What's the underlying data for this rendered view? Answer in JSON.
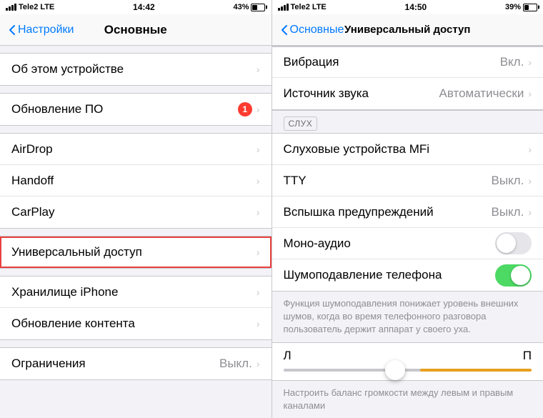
{
  "leftPanel": {
    "statusBar": {
      "carrier": "Tele2",
      "network": "LTE",
      "time": "14:42",
      "battery": 43
    },
    "navBar": {
      "backLabel": "Настройки",
      "title": "Основные"
    },
    "sections": [
      {
        "items": [
          {
            "label": "Об этом устройстве",
            "value": "",
            "badge": ""
          }
        ]
      },
      {
        "items": [
          {
            "label": "Обновление ПО",
            "value": "",
            "badge": "1"
          }
        ]
      },
      {
        "items": [
          {
            "label": "AirDrop",
            "value": "",
            "badge": ""
          },
          {
            "label": "Handoff",
            "value": "",
            "badge": ""
          },
          {
            "label": "CarPlay",
            "value": "",
            "badge": ""
          }
        ]
      },
      {
        "items": [
          {
            "label": "Универсальный доступ",
            "value": "",
            "badge": "",
            "highlighted": true
          }
        ]
      },
      {
        "items": [
          {
            "label": "Хранилище iPhone",
            "value": "",
            "badge": ""
          },
          {
            "label": "Обновление контента",
            "value": "",
            "badge": ""
          }
        ]
      },
      {
        "items": [
          {
            "label": "Ограничения",
            "value": "Выкл.",
            "badge": ""
          }
        ]
      }
    ]
  },
  "rightPanel": {
    "statusBar": {
      "carrier": "Tele2",
      "network": "LTE",
      "time": "14:50",
      "battery": 39
    },
    "navBar": {
      "backLabel": "Основные",
      "title": "Универсальный доступ"
    },
    "topItems": [
      {
        "label": "Вибрация",
        "value": "Вкл."
      },
      {
        "label": "Источник звука",
        "value": "Автоматически"
      }
    ],
    "sectionLabel": "СЛУХ",
    "hearingItems": [
      {
        "label": "Слуховые устройства MFi",
        "value": ""
      },
      {
        "label": "TTY",
        "value": "Выкл."
      },
      {
        "label": "Вспышка предупреждений",
        "value": "Выкл."
      },
      {
        "label": "Моно-аудио",
        "value": "",
        "toggle": "off"
      },
      {
        "label": "Шумоподавление телефона",
        "value": "",
        "toggle": "on"
      }
    ],
    "infoText": "Функция шумоподавления понижает уровень внешних шумов, когда во время телефонного разговора пользователь держит аппарат у своего уха.",
    "sliderLabels": {
      "left": "Л",
      "right": "П"
    },
    "balanceText": "Настроить баланс громкости между левым и правым каналами"
  }
}
